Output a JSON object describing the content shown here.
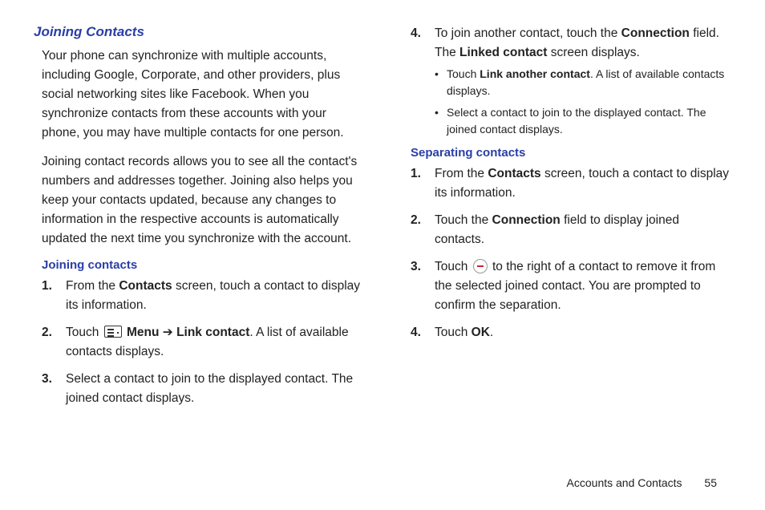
{
  "left": {
    "title": "Joining Contacts",
    "p1": "Your phone can synchronize with multiple accounts, including Google, Corporate, and other providers, plus social networking sites like Facebook. When you synchronize contacts from these accounts with your phone, you may have multiple contacts for one person.",
    "p2": "Joining contact records allows you to see all the contact's numbers and addresses together. Joining also helps you keep your contacts updated, because any changes to information in the respective accounts is automatically updated the next time you synchronize with the account.",
    "sub": "Joining contacts",
    "s1a": "From the ",
    "s1b": "Contacts",
    "s1c": " screen, touch a contact to display its information.",
    "s2a": "Touch ",
    "s2b": "Menu",
    "s2arrow": " ➔ ",
    "s2c": "Link contact",
    "s2d": ". A list of available contacts displays.",
    "s3": "Select a contact to join to the displayed contact. The joined contact displays."
  },
  "right": {
    "s4a": "To join another contact, touch the ",
    "s4b": "Connection",
    "s4c": " field. The ",
    "s4d": "Linked contact",
    "s4e": " screen displays.",
    "b1a": "Touch ",
    "b1b": "Link another contact",
    "b1c": ". A list of available contacts displays.",
    "b2": "Select a contact to join to the displayed contact. The joined contact displays.",
    "sub": "Separating contacts",
    "s1a": "From the ",
    "s1b": "Contacts",
    "s1c": " screen, touch a contact to display its information.",
    "s2a": "Touch the ",
    "s2b": "Connection",
    "s2c": " field to display joined contacts.",
    "s3a": "Touch ",
    "s3b": " to the right of a contact to remove it from the selected joined contact. You are prompted to confirm the separation.",
    "s4a2": "Touch ",
    "s4b2": "OK",
    "s4c2": "."
  },
  "footer": {
    "section": "Accounts and Contacts",
    "page": "55"
  }
}
